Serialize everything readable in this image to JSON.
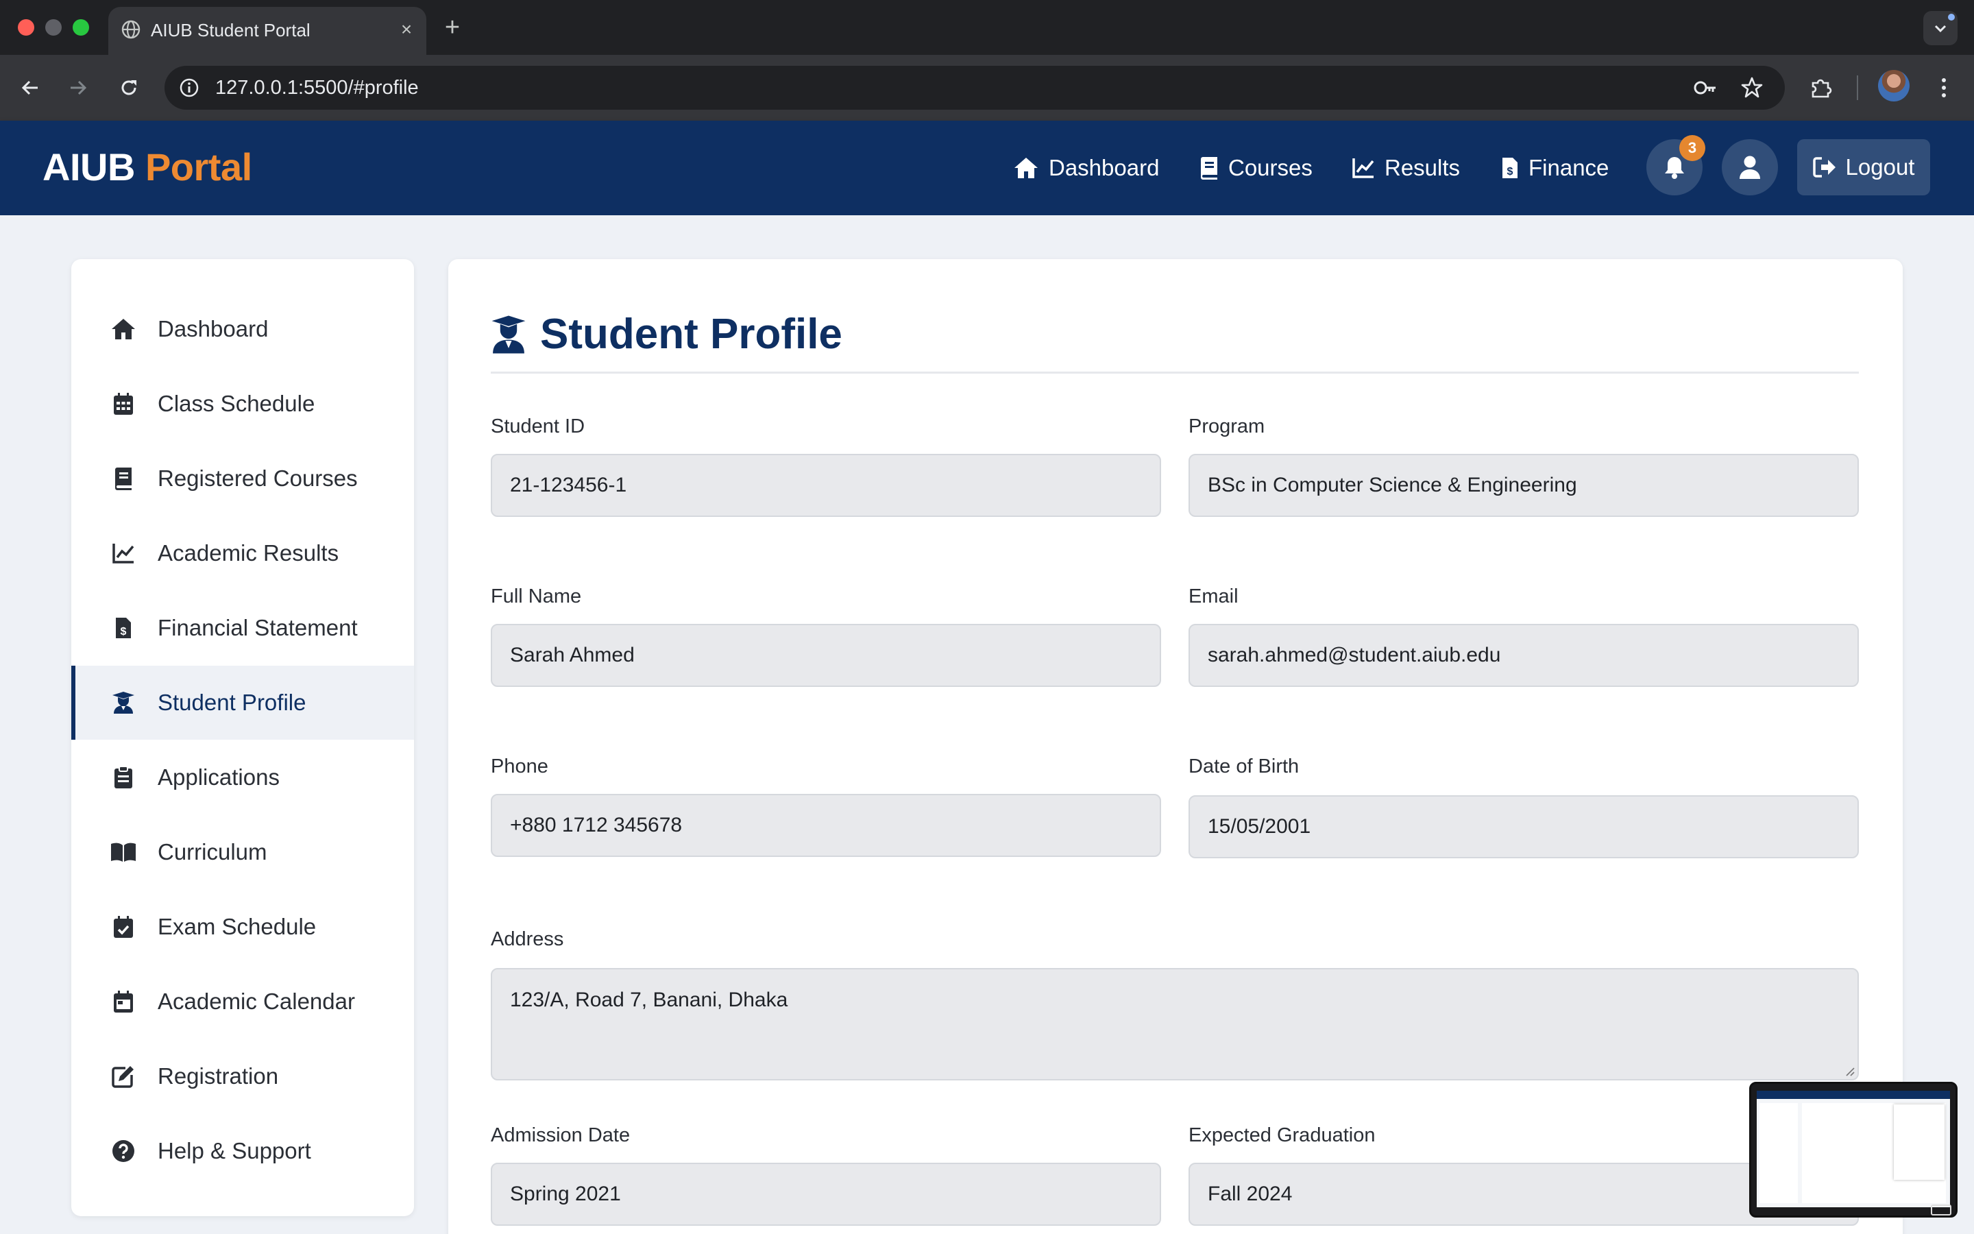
{
  "browser": {
    "tab_title": "AIUB Student Portal",
    "tab_close": "×",
    "new_tab": "+",
    "url": "127.0.0.1:5500/#profile"
  },
  "header": {
    "logo_part1": "AIUB",
    "logo_part2": "Portal",
    "nav": [
      {
        "label": "Dashboard",
        "icon": "home-icon"
      },
      {
        "label": "Courses",
        "icon": "book-icon"
      },
      {
        "label": "Results",
        "icon": "chart-line-icon"
      },
      {
        "label": "Finance",
        "icon": "invoice-dollar-icon"
      }
    ],
    "notification_count": "3",
    "logout_label": "Logout"
  },
  "sidebar": {
    "items": [
      {
        "label": "Dashboard",
        "icon": "home-icon"
      },
      {
        "label": "Class Schedule",
        "icon": "calendar-grid-icon"
      },
      {
        "label": "Registered Courses",
        "icon": "book-icon"
      },
      {
        "label": "Academic Results",
        "icon": "chart-line-icon"
      },
      {
        "label": "Financial Statement",
        "icon": "invoice-dollar-icon"
      },
      {
        "label": "Student Profile",
        "icon": "graduate-icon",
        "active": true
      },
      {
        "label": "Applications",
        "icon": "clipboard-icon"
      },
      {
        "label": "Curriculum",
        "icon": "open-book-icon"
      },
      {
        "label": "Exam Schedule",
        "icon": "calendar-check-icon"
      },
      {
        "label": "Academic Calendar",
        "icon": "calendar-icon"
      },
      {
        "label": "Registration",
        "icon": "edit-icon"
      },
      {
        "label": "Help & Support",
        "icon": "question-circle-icon"
      }
    ]
  },
  "profile": {
    "title": "Student Profile",
    "fields": {
      "student_id": {
        "label": "Student ID",
        "value": "21-123456-1"
      },
      "program": {
        "label": "Program",
        "value": "BSc in Computer Science & Engineering"
      },
      "full_name": {
        "label": "Full Name",
        "value": "Sarah Ahmed"
      },
      "email": {
        "label": "Email",
        "value": "sarah.ahmed@student.aiub.edu"
      },
      "phone": {
        "label": "Phone",
        "value": "+880 1712 345678"
      },
      "dob": {
        "label": "Date of Birth",
        "value": "15/05/2001"
      },
      "address": {
        "label": "Address",
        "value": "123/A, Road 7, Banani, Dhaka"
      },
      "admission_date": {
        "label": "Admission Date",
        "value": "Spring 2021"
      },
      "expected_graduation": {
        "label": "Expected Graduation",
        "value": "Fall 2024"
      }
    }
  },
  "colors": {
    "header_bg": "#0e2f62",
    "accent_orange": "#ee8a32",
    "page_bg": "#eef1f6"
  }
}
